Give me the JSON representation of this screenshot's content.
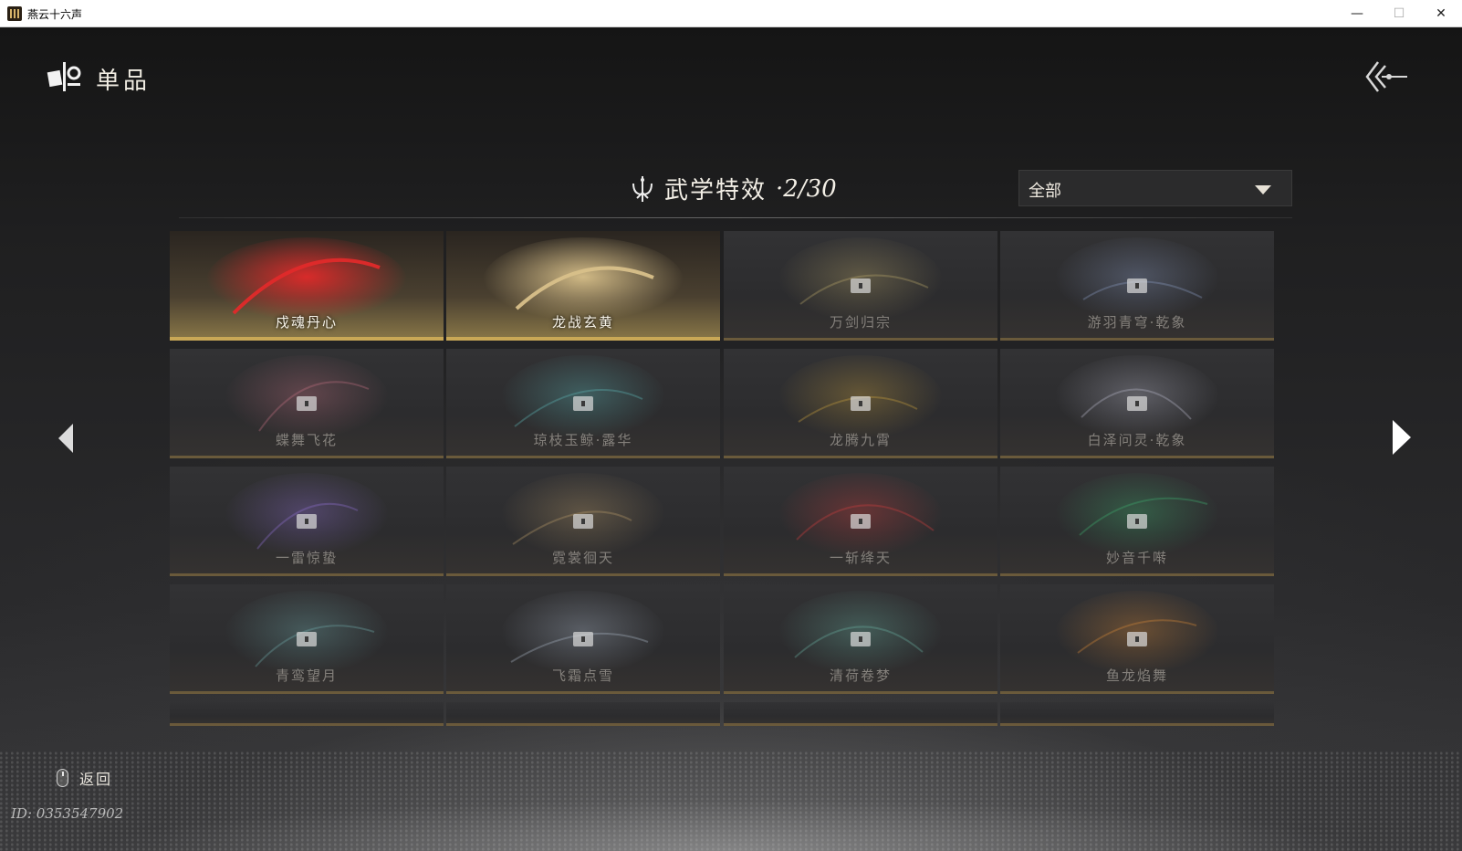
{
  "window": {
    "title": "燕云十六声",
    "min_symbol": "—",
    "max_symbol": "☐",
    "close_symbol": "✕"
  },
  "header": {
    "title": "单品",
    "logo_icon": "item-collection-icon",
    "back_icon": "back-arrow-icon"
  },
  "section": {
    "title": "武学特效",
    "count": "·2/30",
    "icon": "trident-emblem-icon"
  },
  "filter": {
    "selected": "全部"
  },
  "cards": [
    {
      "name": "戍魂丹心",
      "unlocked": true,
      "accent": "#e02a2a"
    },
    {
      "name": "龙战玄黄",
      "unlocked": true,
      "accent": "#d8c08a"
    },
    {
      "name": "万剑归宗",
      "unlocked": false,
      "accent": "#b8a56a"
    },
    {
      "name": "游羽青穹·乾象",
      "unlocked": false,
      "accent": "#8a9ac0"
    },
    {
      "name": "蝶舞飞花",
      "unlocked": false,
      "accent": "#c07080"
    },
    {
      "name": "琼枝玉鲸·露华",
      "unlocked": false,
      "accent": "#5fb8b8"
    },
    {
      "name": "龙腾九霄",
      "unlocked": false,
      "accent": "#c8a040"
    },
    {
      "name": "白泽问灵·乾象",
      "unlocked": false,
      "accent": "#b8b8c8"
    },
    {
      "name": "一雷惊蛰",
      "unlocked": false,
      "accent": "#9070d0"
    },
    {
      "name": "霓裳徊天",
      "unlocked": false,
      "accent": "#b89a6a"
    },
    {
      "name": "一斩绛天",
      "unlocked": false,
      "accent": "#d04040"
    },
    {
      "name": "妙音千啭",
      "unlocked": false,
      "accent": "#40b070"
    },
    {
      "name": "青鸾望月",
      "unlocked": false,
      "accent": "#70a8a8"
    },
    {
      "name": "飞霜点雪",
      "unlocked": false,
      "accent": "#a8b4c4"
    },
    {
      "name": "清荷卷梦",
      "unlocked": false,
      "accent": "#6ab0a0"
    },
    {
      "name": "鱼龙焰舞",
      "unlocked": false,
      "accent": "#d88a3a"
    }
  ],
  "partial_row_count": 4,
  "navigation": {
    "prev_icon": "chevron-left-icon",
    "next_icon": "chevron-right-icon"
  },
  "footer": {
    "back_label": "返回",
    "mouse_icon": "mouse-right-click-icon",
    "user_id": "ID: 0353547902"
  },
  "colors": {
    "gold_accent": "#c9a856",
    "background": "#1f1f20"
  }
}
